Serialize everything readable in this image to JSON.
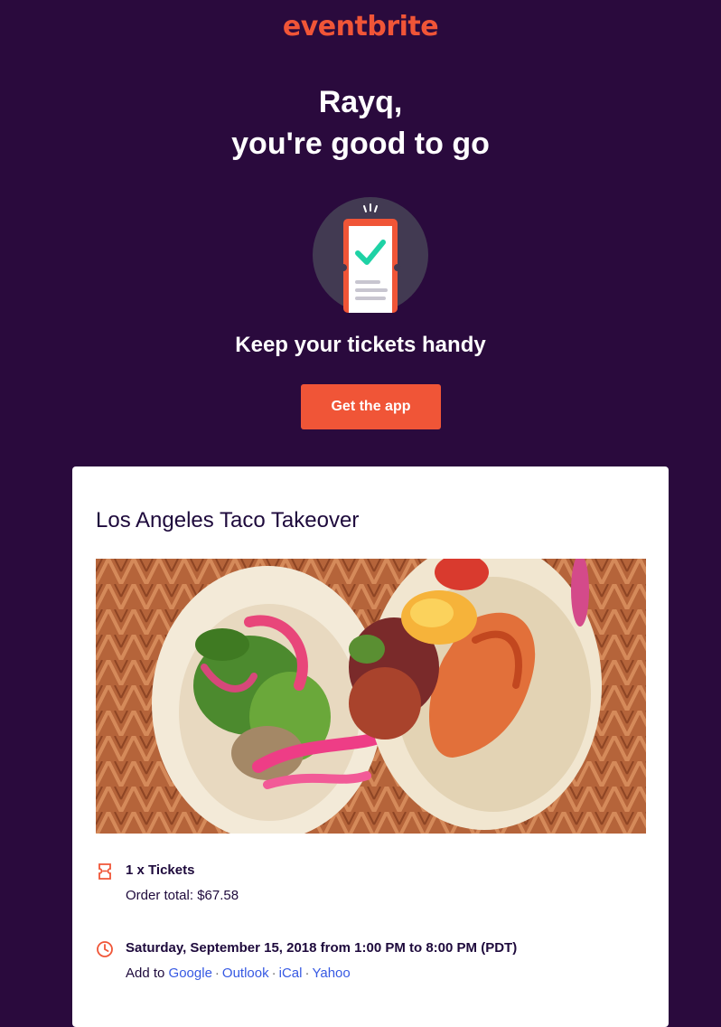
{
  "brand": {
    "logo_text": "eventbrite",
    "accent_color": "#f05537",
    "background_color": "#2a0a3d"
  },
  "hero": {
    "greeting_line1": "Rayq,",
    "greeting_line2": "you're good to go",
    "badge_icon": "phone-ticket-check-icon",
    "tagline": "Keep your tickets handy",
    "cta_label": "Get the app"
  },
  "event": {
    "title": "Los Angeles Taco Takeover",
    "image_description_icon": "tacos-photo",
    "tickets": {
      "icon": "ticket-icon",
      "label": "1 x Tickets",
      "order_total": "Order total: $67.58"
    },
    "schedule": {
      "icon": "clock-icon",
      "date_time": "Saturday, September 15, 2018 from 1:00 PM to 8:00 PM (PDT)",
      "add_to_label": "Add to",
      "calendars": [
        "Google",
        "Outlook",
        "iCal",
        "Yahoo"
      ],
      "separator": "·"
    }
  }
}
